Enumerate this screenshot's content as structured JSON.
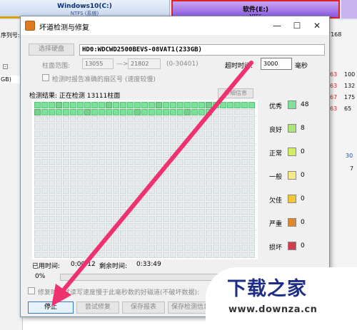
{
  "background": {
    "partitions": [
      {
        "name": "Windows10(C:)",
        "sub": "NTFS (系统)"
      },
      {
        "name": "软件(E:)",
        "sub": "NTFS"
      }
    ],
    "serial_label": "序列号:",
    "gb_label": "GB)",
    "right_values": [
      {
        "text": "7168",
        "tone": "blk"
      },
      {
        "text": "63",
        "tone": "red"
      },
      {
        "text": "100",
        "tone": "blk"
      },
      {
        "text": "63",
        "tone": "red"
      },
      {
        "text": "132",
        "tone": "blk"
      },
      {
        "text": "67",
        "tone": "red"
      },
      {
        "text": "175",
        "tone": "blk"
      },
      {
        "text": "63",
        "tone": "red"
      },
      {
        "text": "65",
        "tone": "blk"
      },
      {
        "text": "30",
        "tone": "blue"
      },
      {
        "text": "7",
        "tone": "blk"
      }
    ]
  },
  "dialog": {
    "title": "坏道检测与修复",
    "window_controls": {
      "minimize": "—",
      "maximize": "☐",
      "close": "✕"
    },
    "select_disk_button": "选择硬盘",
    "disk_name": "HD0:WDCWD2500BEVS-08VAT1(233GB)",
    "cylinder_range_label": "柱面范围:",
    "cylinder_start": "13055",
    "cylinder_arrow": "—>",
    "cylinder_end": "21802",
    "cylinder_hint": "(0-30401)",
    "timeout_label": "超时时间:",
    "timeout_value": "3000",
    "timeout_unit": "毫秒",
    "report_sector_label": "检测时报告准确的扇区号 (速度较慢)",
    "result_label": "检测结果: 正在检测 13111柱面",
    "detail_button": "详细信息",
    "legend": [
      {
        "label": "优秀",
        "count": "48",
        "color": "#7fe09a"
      },
      {
        "label": "良好",
        "count": "8",
        "color": "#a9e67a"
      },
      {
        "label": "正常",
        "count": "0",
        "color": "#d4ee63"
      },
      {
        "label": "一般",
        "count": "0",
        "color": "#f5e98a"
      },
      {
        "label": "欠佳",
        "count": "0",
        "color": "#f4c832"
      },
      {
        "label": "严重",
        "count": "0",
        "color": "#e0862c"
      },
      {
        "label": "损坏",
        "count": "0",
        "color": "#cf3e4d"
      }
    ],
    "elapsed_label": "已用时间:",
    "elapsed_value": "0:00:12",
    "remaining_label": "剩余时间:",
    "remaining_value": "0:33:49",
    "progress_text": "0%",
    "progress_fraction": 0.0,
    "repair_check_label": "修复时尝试读写速度慢于此毫秒数的好磁道(不破坏数据):",
    "buttons": {
      "stop": "停止",
      "try_repair": "尝试修复",
      "save_report": "保存报表",
      "save_status": "保存检测信息"
    },
    "grid": {
      "done_cells": 56
    }
  },
  "watermark": {
    "brand": "下载之家",
    "url": "www.downza.cn"
  },
  "annotation": {
    "arrow_color": "#f0316f"
  }
}
